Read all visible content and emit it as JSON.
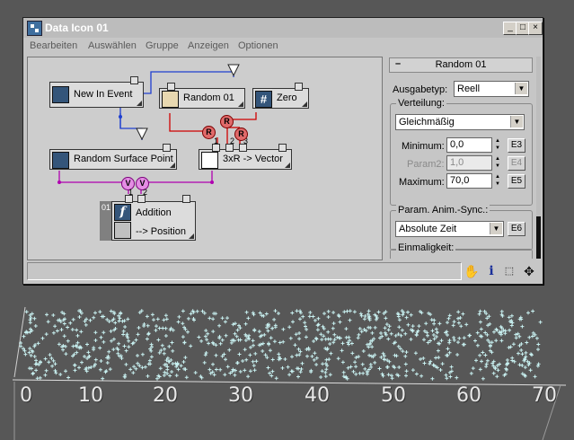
{
  "window": {
    "title": "Data Icon 01",
    "buttons": [
      "_",
      "□",
      "×"
    ]
  },
  "menu": [
    "Bearbeiten",
    "Auswählen",
    "Gruppe",
    "Anzeigen",
    "Optionen"
  ],
  "graph": {
    "nodes": {
      "new_in_event": "New In Event",
      "random01": "Random 01",
      "zero": "Zero",
      "random_surface_point": "Random Surface Point",
      "vector": "3xR -> Vector",
      "addition_index": "01",
      "addition": "Addition",
      "position": "--> Position"
    },
    "r_label": "R",
    "v_label": "V",
    "ports": [
      "1",
      "2",
      "3",
      "1",
      "2"
    ]
  },
  "panel": {
    "rollout_title": "Random 01",
    "minus": "–",
    "ausgabetyp_label": "Ausgabetyp:",
    "ausgabetyp_value": "Reell",
    "verteilung_label": "Verteilung:",
    "verteilung_value": "Gleichmäßig",
    "minimum_label": "Minimum:",
    "minimum_value": "0,0",
    "minimum_btn": "E3",
    "param2_label": "Param2:",
    "param2_value": "1,0",
    "param2_btn": "E4",
    "maximum_label": "Maximum:",
    "maximum_value": "70,0",
    "maximum_btn": "E5",
    "sync_label": "Param. Anim.-Sync.:",
    "sync_value": "Absolute Zeit",
    "sync_btn": "E6",
    "einmaligkeit_label": "Einmaligkeit:"
  },
  "toolbar_icons": [
    "hand-icon",
    "info-icon",
    "select-icon",
    "move-icon"
  ],
  "viewport": {
    "ticks": [
      "0",
      "10",
      "20",
      "30",
      "40",
      "50",
      "60",
      "70"
    ],
    "particle_color": "#c8f0f0"
  }
}
